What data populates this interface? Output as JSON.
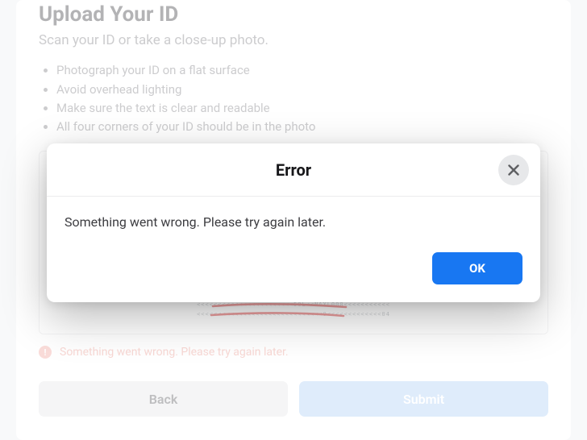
{
  "page": {
    "title": "Upload Your ID",
    "subtitle": "Scan your ID or take a close-up photo.",
    "instructions": [
      "Photograph your ID on a flat surface",
      "Avoid overhead lighting",
      "Make sure the text is clear and readable",
      "All four corners of your ID should be in the photo"
    ],
    "inline_error": "Something went wrong. Please try again later.",
    "buttons": {
      "back": "Back",
      "submit": "Submit"
    }
  },
  "modal": {
    "title": "Error",
    "message": "Something went wrong. Please try again later.",
    "ok": "OK"
  },
  "icons": {
    "close": "close-icon",
    "alert": "alert-icon"
  },
  "colors": {
    "primary": "#1877f2",
    "submit_disabled": "#b8d5f7",
    "error_text": "#f0a8a1"
  }
}
